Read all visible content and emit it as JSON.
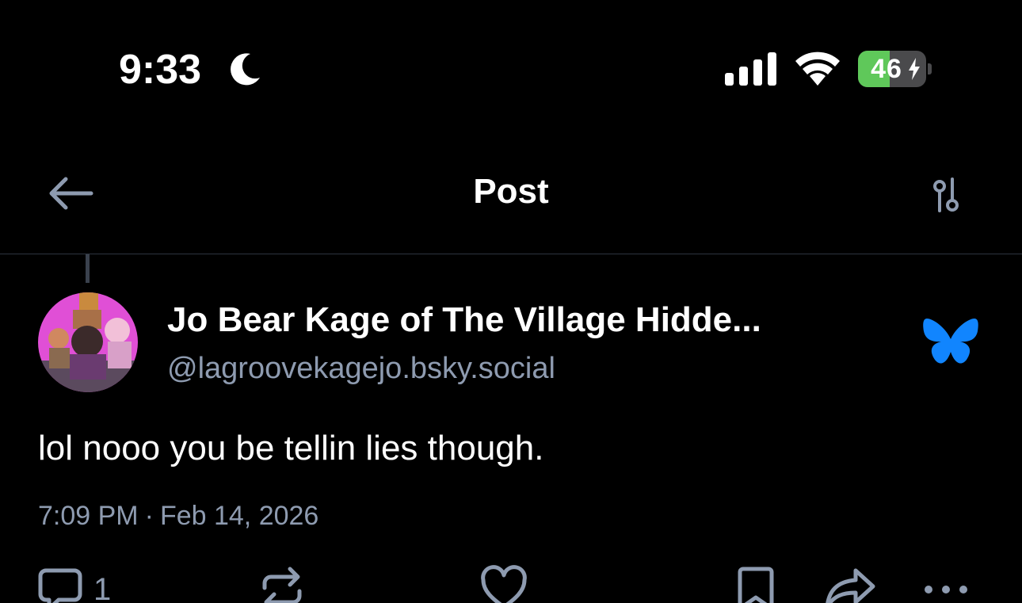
{
  "status_bar": {
    "time": "9:33",
    "battery": "46",
    "battery_level": 0.46
  },
  "header": {
    "title": "Post"
  },
  "post": {
    "author_name": "Jo Bear Kage of The Village Hidde...",
    "author_handle": "@lagroovekagejo.bsky.social",
    "text": "lol nooo you be tellin lies though.",
    "time": "7:09 PM",
    "separator": "·",
    "date": "Feb 14, 2026"
  },
  "actions": {
    "reply_count": "1"
  },
  "colors": {
    "background": "#000000",
    "secondary_text": "#8e9bb0",
    "brand_blue": "#1185fe",
    "battery_green": "#5fc85a",
    "avatar_magenta": "#e04fd6"
  },
  "icons": {
    "moon": "moon-icon",
    "back": "arrow-left-icon",
    "settings": "sliders-icon",
    "brand": "bluesky-butterfly-icon",
    "reply": "speech-bubble-icon",
    "repost": "repost-icon",
    "like": "heart-icon",
    "bookmark": "bookmark-icon",
    "share": "share-icon",
    "more": "ellipsis-icon"
  }
}
